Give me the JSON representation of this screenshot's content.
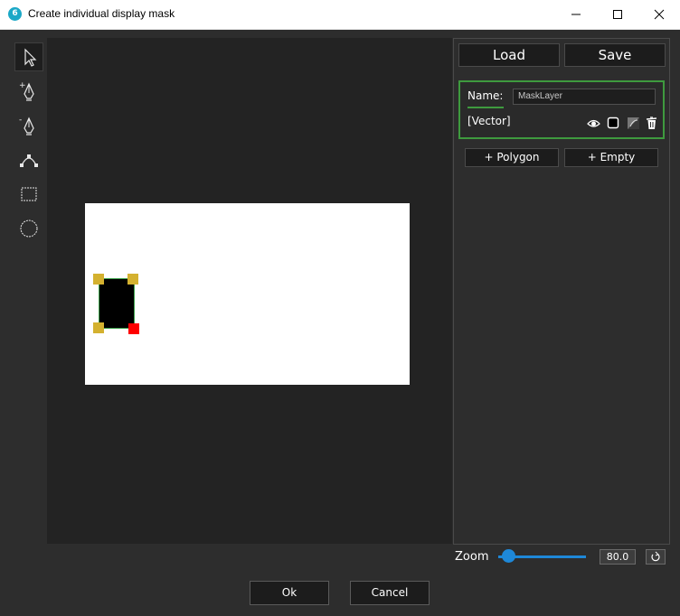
{
  "window": {
    "title": "Create individual display mask",
    "app_icon_glyph": "6",
    "accent": "#1ba8c7"
  },
  "tools": [
    {
      "name": "select-arrow-icon",
      "active": true
    },
    {
      "name": "pen-add-icon",
      "active": false
    },
    {
      "name": "pen-remove-icon",
      "active": false
    },
    {
      "name": "bezier-curve-icon",
      "active": false
    },
    {
      "name": "rectangle-icon",
      "active": false
    },
    {
      "name": "ellipse-icon",
      "active": false
    }
  ],
  "panel": {
    "load_label": "Load",
    "save_label": "Save",
    "layer": {
      "name_label": "Name:",
      "name_value": "MaskLayer",
      "type_label": "[Vector]",
      "icons": [
        "eye-icon",
        "color-swatch-icon",
        "invert-icon",
        "trash-icon"
      ],
      "border_color": "#3e9a3e"
    },
    "add_polygon_label": "+ Polygon",
    "add_empty_label": "+ Empty"
  },
  "zoom": {
    "label": "Zoom",
    "value": "80.0",
    "accent": "#1e88d8"
  },
  "dialog": {
    "ok_label": "Ok",
    "cancel_label": "Cancel"
  },
  "colors": {
    "handle": "#d4b12f",
    "active_handle": "#ff0000",
    "shape_outline": "#3fa34d"
  }
}
